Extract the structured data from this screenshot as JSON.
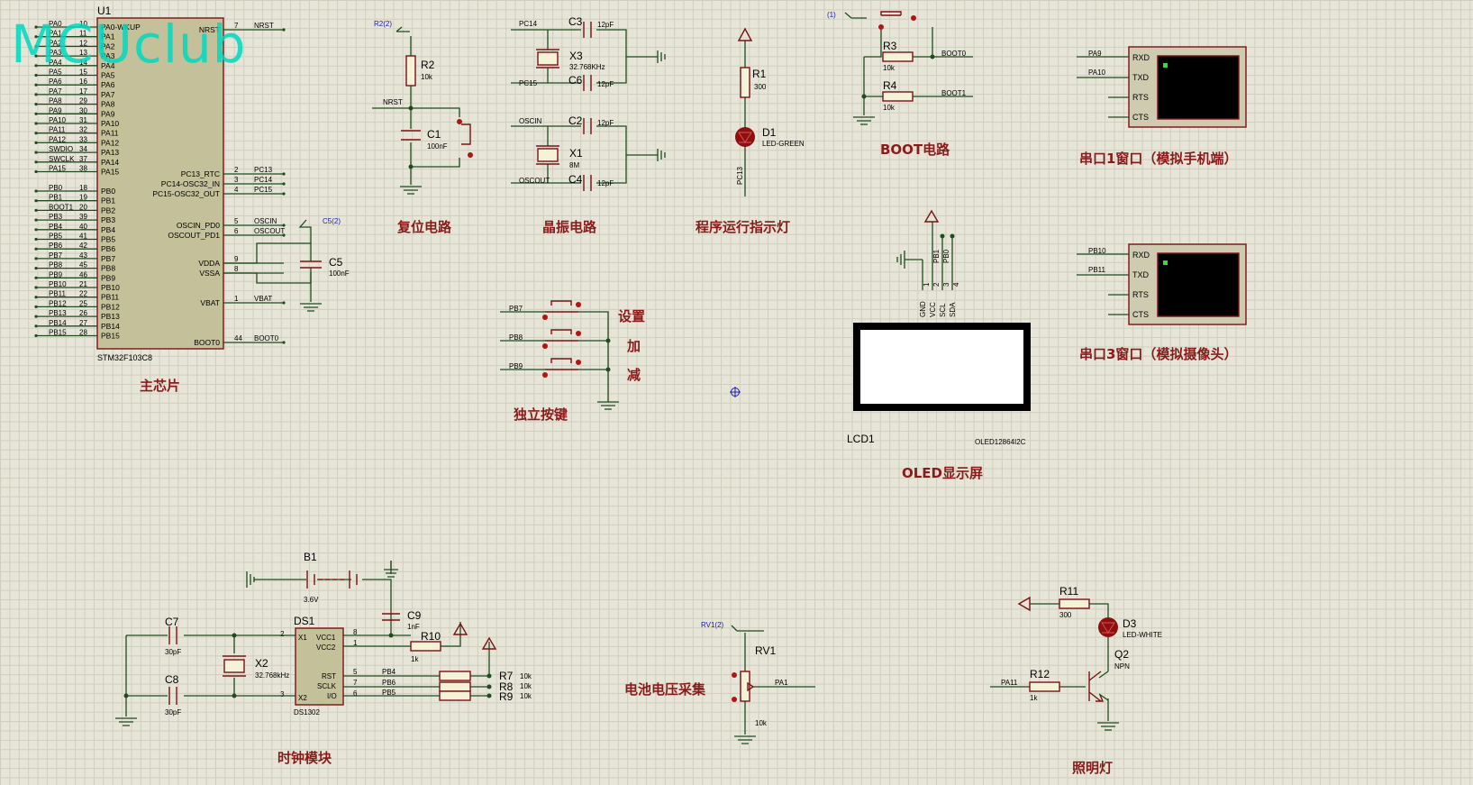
{
  "watermark": "MCUclub",
  "colors": {
    "background": "#e6e5d7",
    "grid": "#cfcebf",
    "wire": "#1f4b1f",
    "component": "#7a1212",
    "caption": "#8b1a1a",
    "label_blue": "#1a1ab8",
    "mcu_fill": "#c4c19a"
  },
  "captions": {
    "main_chip": "主芯片",
    "reset": "复位电路",
    "crystal": "晶振电路",
    "led_indicator": "程序运行指示灯",
    "boot": "BOOT电路",
    "uart1": "串口1窗口（模拟手机端）",
    "uart3": "串口3窗口（模拟摄像头）",
    "keys": "独立按键",
    "oled": "OLED显示屏",
    "clock": "时钟模块",
    "battery": "电池电压采集",
    "lighting": "照明灯",
    "key_set": "设置",
    "key_add": "加",
    "key_sub": "减"
  },
  "mcu": {
    "ref": "U1",
    "part": "STM32F103C8",
    "left_pins": [
      {
        "net": "PA0",
        "num": "10",
        "name": "PA0-WKUP"
      },
      {
        "net": "PA1",
        "num": "11",
        "name": "PA1"
      },
      {
        "net": "PA2",
        "num": "12",
        "name": "PA2"
      },
      {
        "net": "PA3",
        "num": "13",
        "name": "PA3"
      },
      {
        "net": "PA4",
        "num": "14",
        "name": "PA4"
      },
      {
        "net": "PA5",
        "num": "15",
        "name": "PA5"
      },
      {
        "net": "PA6",
        "num": "16",
        "name": "PA6"
      },
      {
        "net": "PA7",
        "num": "17",
        "name": "PA7"
      },
      {
        "net": "PA8",
        "num": "29",
        "name": "PA8"
      },
      {
        "net": "PA9",
        "num": "30",
        "name": "PA9"
      },
      {
        "net": "PA10",
        "num": "31",
        "name": "PA10"
      },
      {
        "net": "PA11",
        "num": "32",
        "name": "PA11"
      },
      {
        "net": "PA12",
        "num": "33",
        "name": "PA12"
      },
      {
        "net": "SWDIO",
        "num": "34",
        "name": "PA13"
      },
      {
        "net": "SWCLK",
        "num": "37",
        "name": "PA14"
      },
      {
        "net": "PA15",
        "num": "38",
        "name": "PA15"
      },
      {
        "net": "PB0",
        "num": "18",
        "name": "PB0"
      },
      {
        "net": "PB1",
        "num": "19",
        "name": "PB1"
      },
      {
        "net": "BOOT1",
        "num": "20",
        "name": "PB2"
      },
      {
        "net": "PB3",
        "num": "39",
        "name": "PB3"
      },
      {
        "net": "PB4",
        "num": "40",
        "name": "PB4"
      },
      {
        "net": "PB5",
        "num": "41",
        "name": "PB5"
      },
      {
        "net": "PB6",
        "num": "42",
        "name": "PB6"
      },
      {
        "net": "PB7",
        "num": "43",
        "name": "PB7"
      },
      {
        "net": "PB8",
        "num": "45",
        "name": "PB8"
      },
      {
        "net": "PB9",
        "num": "46",
        "name": "PB9"
      },
      {
        "net": "PB10",
        "num": "21",
        "name": "PB10"
      },
      {
        "net": "PB11",
        "num": "22",
        "name": "PB11"
      },
      {
        "net": "PB12",
        "num": "25",
        "name": "PB12"
      },
      {
        "net": "PB13",
        "num": "26",
        "name": "PB13"
      },
      {
        "net": "PB14",
        "num": "27",
        "name": "PB14"
      },
      {
        "net": "PB15",
        "num": "28",
        "name": "PB15"
      }
    ],
    "right_pins": [
      {
        "name": "NRST",
        "num": "7",
        "net": "NRST"
      },
      {
        "name": "PC13_RTC",
        "num": "2",
        "net": "PC13"
      },
      {
        "name": "PC14-OSC32_IN",
        "num": "3",
        "net": "PC14"
      },
      {
        "name": "PC15-OSC32_OUT",
        "num": "4",
        "net": "PC15"
      },
      {
        "name": "OSCIN_PD0",
        "num": "5",
        "net": "OSCIN"
      },
      {
        "name": "OSCOUT_PD1",
        "num": "6",
        "net": "OSCOUT"
      },
      {
        "name": "VDDA",
        "num": "9",
        "net": ""
      },
      {
        "name": "VSSA",
        "num": "8",
        "net": ""
      },
      {
        "name": "VBAT",
        "num": "1",
        "net": "VBAT"
      },
      {
        "name": "BOOT0",
        "num": "44",
        "net": "BOOT0"
      }
    ]
  },
  "parts": {
    "R2": {
      "ref": "R2",
      "value": "10k",
      "probe": "R2(2)"
    },
    "C1": {
      "ref": "C1",
      "value": "100nF"
    },
    "nrst_net": "NRST",
    "C5": {
      "ref": "C5",
      "value": "100nF",
      "probe": "C5(2)"
    },
    "C3": {
      "ref": "C3",
      "value": "12pF"
    },
    "C6": {
      "ref": "C6",
      "value": "12pF"
    },
    "X3": {
      "ref": "X3",
      "value": "32.768KHz"
    },
    "C2": {
      "ref": "C2",
      "value": "12pF"
    },
    "C4": {
      "ref": "C4",
      "value": "12pF"
    },
    "X1": {
      "ref": "X1",
      "value": "8M"
    },
    "pc14": "PC14",
    "pc15": "PC15",
    "oscin": "OSCIN",
    "oscout": "OSCOUT",
    "R1": {
      "ref": "R1",
      "value": "300"
    },
    "D1": {
      "ref": "D1",
      "value": "LED-GREEN",
      "net": "PC13"
    },
    "R3": {
      "ref": "R3",
      "value": "10k",
      "net": "BOOT0"
    },
    "R4": {
      "ref": "R4",
      "value": "10k",
      "net": "BOOT1"
    },
    "boot_probe": "(1)",
    "keys": [
      "PB7",
      "PB8",
      "PB9"
    ],
    "lcd": {
      "ref": "LCD1",
      "part": "OLED12864I2C",
      "pins": [
        "GND",
        "VCC",
        "SCL",
        "SDA"
      ],
      "nets": [
        "PB1",
        "PB0"
      ],
      "nums": [
        "1",
        "2",
        "3",
        "4"
      ]
    },
    "term1": {
      "nets": [
        "PA9",
        "PA10"
      ],
      "pins": [
        "RXD",
        "TXD",
        "RTS",
        "CTS"
      ]
    },
    "term3": {
      "nets": [
        "PB10",
        "PB11"
      ],
      "pins": [
        "RXD",
        "TXD",
        "RTS",
        "CTS"
      ]
    },
    "B1": {
      "ref": "B1",
      "value": "3.6V"
    },
    "C7": {
      "ref": "C7",
      "value": "30pF"
    },
    "C8": {
      "ref": "C8",
      "value": "30pF"
    },
    "X2": {
      "ref": "X2",
      "value": "32.768kHz"
    },
    "C9": {
      "ref": "C9",
      "value": "1nF"
    },
    "R10": {
      "ref": "R10",
      "value": "1k"
    },
    "DS1": {
      "ref": "DS1",
      "part": "DS1302",
      "pins": {
        "X1": "X1",
        "X2": "X2",
        "VCC1": "VCC1",
        "VCC2": "VCC2",
        "RST": "RST",
        "SCLK": "SCLK",
        "IO": "I/O"
      },
      "nums": [
        "2",
        "3",
        "8",
        "1",
        "5",
        "7",
        "6"
      ]
    },
    "R7": {
      "ref": "R7",
      "value": "10k",
      "net": "PB4"
    },
    "R8": {
      "ref": "R8",
      "value": "10k",
      "net": "PB6"
    },
    "R9": {
      "ref": "R9",
      "value": "10k",
      "net": "PB5"
    },
    "RV1": {
      "ref": "RV1",
      "value": "10k",
      "probe": "RV1(2)",
      "net": "PA1"
    },
    "R11": {
      "ref": "R11",
      "value": "300"
    },
    "D3": {
      "ref": "D3",
      "value": "LED-WHITE"
    },
    "Q2": {
      "ref": "Q2",
      "value": "NPN"
    },
    "R12": {
      "ref": "R12",
      "value": "1k",
      "net": "PA11"
    }
  }
}
